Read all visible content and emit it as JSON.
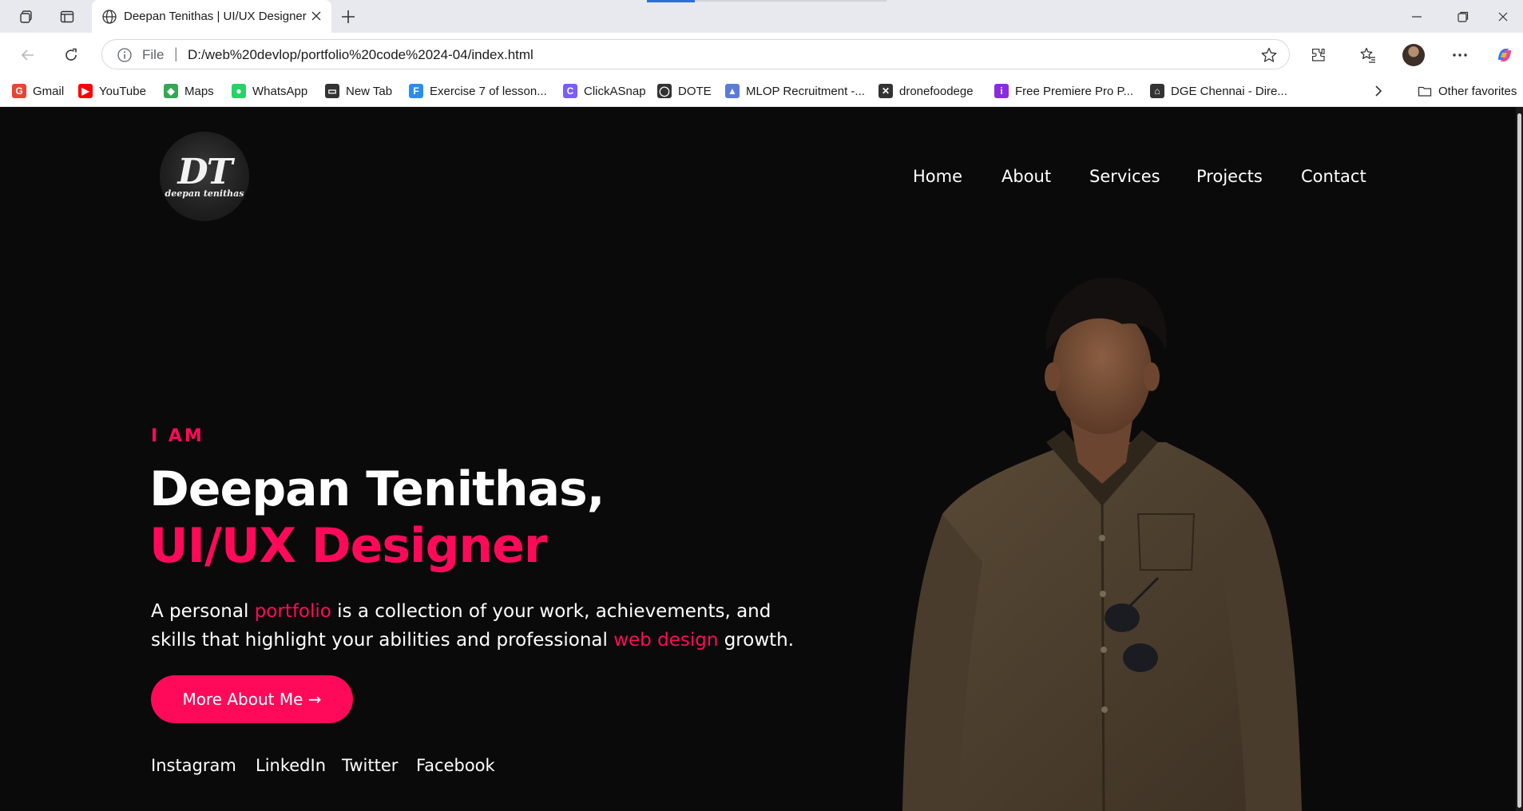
{
  "browser": {
    "tab_title": "Deepan Tenithas | UI/UX Designer",
    "omnibox_scheme": "File",
    "url": "D:/web%20devlop/portfolio%20code%2024-04/index.html",
    "bookmarks": [
      {
        "label": "Gmail",
        "icon": "gmail-icon",
        "color": "#ea4335"
      },
      {
        "label": "YouTube",
        "icon": "youtube-icon",
        "color": "#ff0000"
      },
      {
        "label": "Maps",
        "icon": "maps-icon",
        "color": "#34a853"
      },
      {
        "label": "WhatsApp",
        "icon": "whatsapp-icon",
        "color": "#25d366"
      },
      {
        "label": "New Tab",
        "icon": "newtab-icon",
        "color": "#333333"
      },
      {
        "label": "Exercise 7 of lesson...",
        "icon": "exercise-icon",
        "color": "#2d8cf0"
      },
      {
        "label": "ClickASnap",
        "icon": "clickasnap-icon",
        "color": "#7b5cff"
      },
      {
        "label": "DOTE",
        "icon": "globe-icon",
        "color": "#333333"
      },
      {
        "label": "MLOP Recruitment -...",
        "icon": "mlop-icon",
        "color": "#5a7bd8"
      },
      {
        "label": "dronefoodege",
        "icon": "drone-icon",
        "color": "#333333"
      },
      {
        "label": "Free Premiere Pro P...",
        "icon": "premiere-icon",
        "color": "#8a2be2"
      },
      {
        "label": "DGE Chennai - Dire...",
        "icon": "graduation-cap-icon",
        "color": "#333333"
      }
    ],
    "other_favorites": "Other favorites"
  },
  "site": {
    "logo_mark": "DT",
    "logo_sub": "deepan tenithas",
    "nav": [
      "Home",
      "About",
      "Services",
      "Projects",
      "Contact"
    ],
    "eyebrow": "I AM",
    "name": "Deepan Tenithas,",
    "role": "UI/UX Designer",
    "lead": {
      "p1": "A personal ",
      "hl1": "portfolio",
      "p2": " is a collection of your work, achievements, and skills that highlight your abilities and professional ",
      "hl2": "web design",
      "p3": " growth."
    },
    "cta": "More About Me →",
    "social": [
      "Instagram",
      "LinkedIn",
      "Twitter",
      "Facebook"
    ],
    "accent_color": "#ff0a5a"
  }
}
